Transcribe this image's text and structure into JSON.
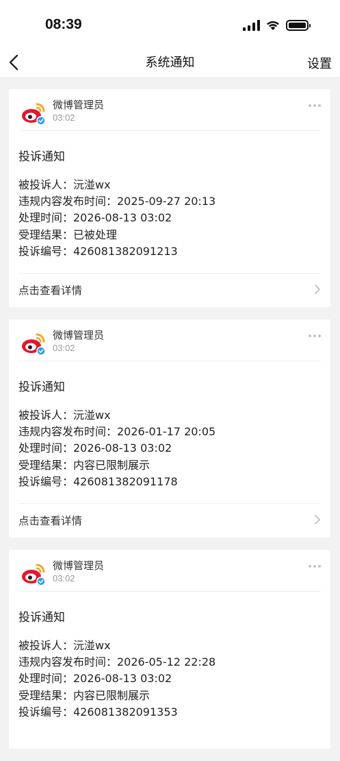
{
  "status_bar": {
    "time": "08:39"
  },
  "nav": {
    "title": "系统通知",
    "settings_label": "设置"
  },
  "cards": [
    {
      "sender": "微博管理员",
      "time": "03:02",
      "title": "投诉通知",
      "lines": [
        "被投诉人：沅湴wx",
        "违规内容发布时间：2025-09-27 20:13",
        "处理时间：2026-08-13 03:02",
        "受理结果：已被处理",
        "投诉编号：426081382091213"
      ],
      "footer": "点击查看详情"
    },
    {
      "sender": "微博管理员",
      "time": "03:02",
      "title": "投诉通知",
      "lines": [
        "被投诉人：沅湴wx",
        "违规内容发布时间：2026-01-17 20:05",
        "处理时间：2026-08-13 03:02",
        "受理结果：内容已限制展示",
        "投诉编号：426081382091178"
      ],
      "footer": "点击查看详情"
    },
    {
      "sender": "微博管理员",
      "time": "03:02",
      "title": "投诉通知",
      "lines": [
        "被投诉人：沅湴wx",
        "违规内容发布时间：2026-05-12 22:28",
        "处理时间：2026-08-13 03:02",
        "受理结果：内容已限制展示",
        "投诉编号：426081382091353"
      ]
    }
  ],
  "colors": {
    "background": "#f2f2f2",
    "card": "#ffffff",
    "weibo_red": "#e6162d",
    "weibo_orange": "#f5a623",
    "verified_blue": "#2a9ff0"
  },
  "icons": {
    "back": "chevron-left-icon",
    "more": "more-dots-icon",
    "avatar": "weibo-logo-icon",
    "verified": "verified-badge-icon",
    "chevron": "chevron-right-icon"
  }
}
